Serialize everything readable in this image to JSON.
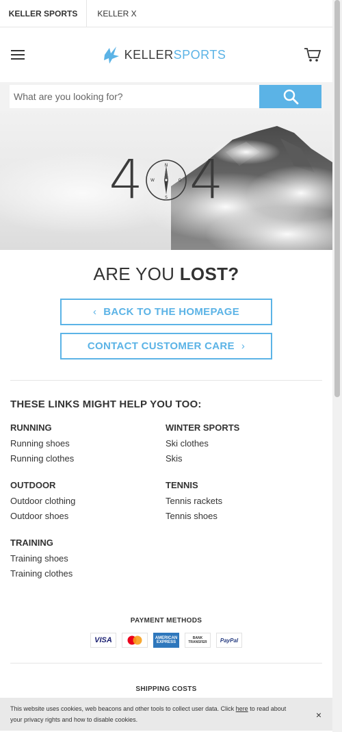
{
  "top_tabs": [
    {
      "label": "KELLER SPORTS",
      "active": true
    },
    {
      "label": "KELLER X",
      "active": false
    }
  ],
  "header": {
    "logo_part1": "KELLER",
    "logo_part2": "SPORTS",
    "menu_icon": "hamburger-menu-icon",
    "cart_icon": "shopping-cart-icon"
  },
  "search": {
    "placeholder": "What are you looking for?",
    "button_icon": "search-icon"
  },
  "hero": {
    "digit_left": "4",
    "digit_right": "4",
    "compass_n": "N",
    "compass_s": "S",
    "compass_w": "W",
    "compass_o": "O"
  },
  "lost": {
    "text_light": "ARE YOU ",
    "text_bold": "LOST?"
  },
  "buttons": {
    "back_home": "BACK TO THE HOMEPAGE",
    "contact": "CONTACT CUSTOMER CARE"
  },
  "links_section": {
    "title": "THESE LINKS MIGHT HELP YOU TOO:",
    "groups": [
      {
        "category": "RUNNING",
        "links": [
          "Running shoes",
          "Running clothes"
        ]
      },
      {
        "category": "WINTER SPORTS",
        "links": [
          "Ski clothes",
          "Skis"
        ]
      },
      {
        "category": "OUTDOOR",
        "links": [
          "Outdoor clothing",
          "Outdoor shoes"
        ]
      },
      {
        "category": "TENNIS",
        "links": [
          "Tennis rackets",
          "Tennis shoes"
        ]
      },
      {
        "category": "TRAINING",
        "links": [
          "Training shoes",
          "Training clothes"
        ]
      }
    ]
  },
  "payment": {
    "title": "PAYMENT METHODS",
    "methods": [
      "VISA",
      "mastercard",
      "AMERICAN EXPRESS",
      "BANK TRANSFER",
      "PayPal"
    ],
    "visa": "VISA",
    "amex_1": "AMERICAN",
    "amex_2": "EXPRESS",
    "bank_1": "BANK",
    "bank_2": "TRANSFER",
    "paypal": "PayPal"
  },
  "shipping": {
    "title": "SHIPPING COSTS"
  },
  "cookie": {
    "text_before": "This website uses cookies, web beacons and other tools to collect user data. Click ",
    "link": "here",
    "text_after": " to read about your privacy rights and how to disable cookies.",
    "close": "×"
  },
  "colors": {
    "accent": "#5bb3e6",
    "text": "#333333"
  }
}
